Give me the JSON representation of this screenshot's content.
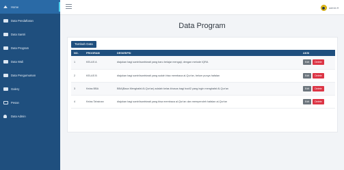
{
  "sidebar": {
    "items": [
      {
        "label": "Home",
        "icon": "home-icon",
        "active": true
      },
      {
        "label": "Data Pendaftaran",
        "icon": "monitor-icon"
      },
      {
        "label": "Data Santri",
        "icon": "monitor-icon"
      },
      {
        "label": "Data Program",
        "icon": "folder-icon"
      },
      {
        "label": "Data Wali",
        "icon": "folder-icon"
      },
      {
        "label": "Data Pengumuman",
        "icon": "folder-icon"
      },
      {
        "label": "Galery",
        "icon": "image-icon"
      },
      {
        "label": "Pesan",
        "icon": "card-icon"
      },
      {
        "label": "Data Admin",
        "icon": "user-icon"
      }
    ]
  },
  "header": {
    "user_label": "admin ▾"
  },
  "page": {
    "title": "Data Program"
  },
  "panel": {
    "add_button_label": "Tambah Data"
  },
  "table": {
    "headers": [
      "NO.",
      "PROGRAM",
      "DESKRIPSI",
      "AKSI"
    ],
    "rows": [
      {
        "no": "1",
        "program": "KELAS A",
        "desc": "diajukan bagi santri/santriwati yang baru belajar mengaji, dengan metode IQRA",
        "edit": "Edit",
        "delete": "Delete"
      },
      {
        "no": "2",
        "program": "KELAS B",
        "desc": "diajukan bagi santri/santriwati yang sudah bisa membaca al-Qur'an, belum punya hafalan",
        "edit": "Edit",
        "delete": "Delete"
      },
      {
        "no": "3",
        "program": "Kelas BBA",
        "desc": "BBA(Baca Menghafal Al-Qur'an) adalah kelas khusus bagi bocil2 yang ingin menghafal Al-Qur'an",
        "edit": "Edit",
        "delete": "Delete"
      },
      {
        "no": "4",
        "program": "Kelas Tahsinan",
        "desc": "diajukan bagi santri/santriwati yang bisa membaca al-Qur'an dan memperoleh hafalan al-Qur'an",
        "edit": "Edit",
        "delete": "Delete"
      }
    ]
  },
  "colors": {
    "sidebar": "#1f4f7e",
    "sidebar_active": "#2a6aa6",
    "accent_bar": "#4fd2f0",
    "edit": "#6c757d",
    "delete": "#dc3545"
  }
}
